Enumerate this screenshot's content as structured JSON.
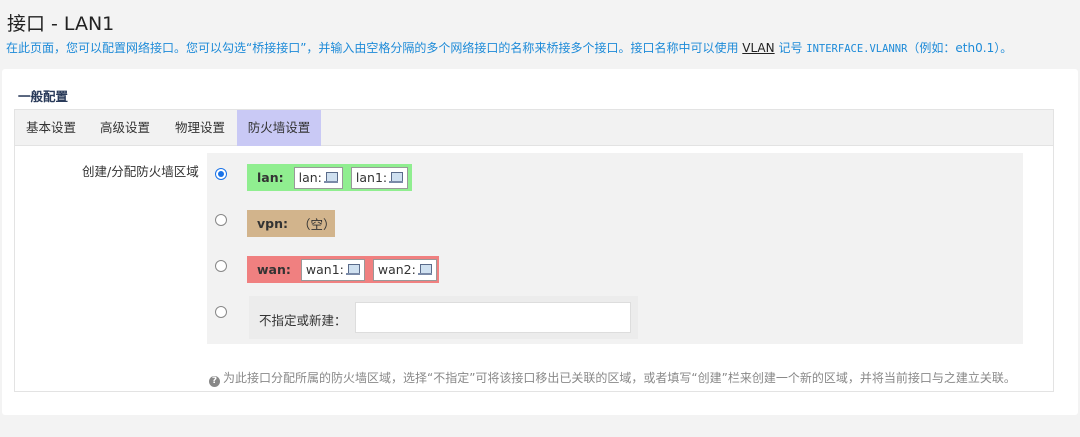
{
  "page": {
    "title": "接口 - LAN1",
    "description_prefix": "在此页面，您可以配置网络接口。您可以勾选“桥接接口”，并输入由空格分隔的多个网络接口的名称来桥接多个接口。接口名称中可以使用 ",
    "description_link": "VLAN",
    "description_mid": " 记号 ",
    "description_code": "INTERFACE.VLANNR",
    "description_suffix": "（例如：eth0.1）。"
  },
  "section": {
    "title": "一般配置"
  },
  "tabs": [
    {
      "label": "基本设置",
      "active": false
    },
    {
      "label": "高级设置",
      "active": false
    },
    {
      "label": "物理设置",
      "active": false
    },
    {
      "label": "防火墙设置",
      "active": true
    }
  ],
  "firewall": {
    "field_label": "创建/分配防火墙区域",
    "zones": [
      {
        "name": "lan:",
        "color": "#90ee90",
        "selected": true,
        "chips": [
          "lan:",
          "lan1:"
        ],
        "empty_text": ""
      },
      {
        "name": "vpn:",
        "color": "#d2b48c",
        "selected": false,
        "chips": [],
        "empty_text": "（空）"
      },
      {
        "name": "wan:",
        "color": "#f08080",
        "selected": false,
        "chips": [
          "wan1:",
          "wan2:"
        ],
        "empty_text": ""
      }
    ],
    "new_zone": {
      "label": "不指定或新建：",
      "value": "",
      "placeholder": ""
    },
    "help_text": "为此接口分配所属的防火墙区域，选择“不指定”可将该接口移出已关联的区域，或者填写“创建”栏来创建一个新的区域，并将当前接口与之建立关联。"
  },
  "icons": {
    "interface": "network-interface-icon",
    "help": "question-circle-icon"
  }
}
